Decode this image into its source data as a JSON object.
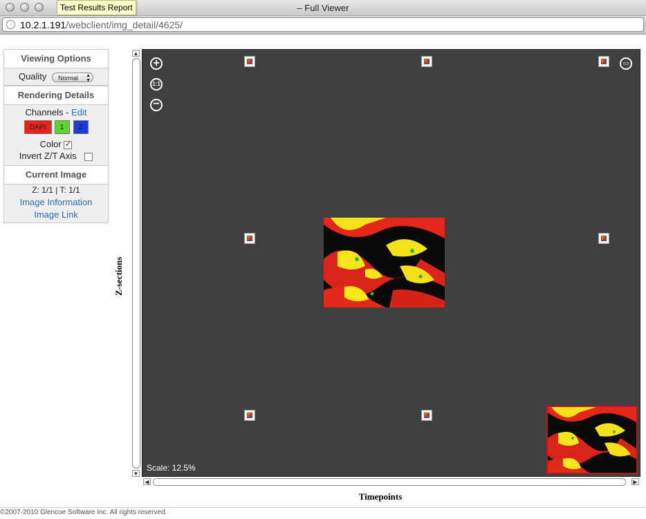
{
  "window": {
    "title": "– Full Viewer",
    "tooltip": "Test Results Report",
    "url_host": "10.2.1.191",
    "url_path": "/webclient/img_detail/4625/"
  },
  "panel": {
    "viewing_options": "Viewing Options",
    "quality_label": "Quality",
    "quality_value": "Normal",
    "rendering_details": "Rendering Details",
    "channels_label": "Channels -",
    "channels_edit": "Edit",
    "channels": [
      {
        "label": "DAPI",
        "color": "#e8231b"
      },
      {
        "label": "1",
        "color": "#5bd62c"
      },
      {
        "label": "2",
        "color": "#1f3bd8"
      }
    ],
    "color_label": "Color",
    "color_checked": true,
    "invert_label": "Invert Z/T Axis",
    "invert_checked": false,
    "current_image": "Current Image",
    "zt_status": "Z: 1/1 | T: 1/1",
    "image_information": "Image Information",
    "image_link": "Image Link"
  },
  "viewer": {
    "z_label": "Z-sections",
    "t_label": "Timepoints",
    "scale": "Scale: 12.5%",
    "zoom_reset_label": "1:1"
  },
  "footer": "©2007-2010 Glencoe Software Inc. All rights reserved.",
  "colors": {
    "viewport_bg": "#404040",
    "thumb_border": "#b41c1c",
    "link": "#2c6fbd"
  }
}
